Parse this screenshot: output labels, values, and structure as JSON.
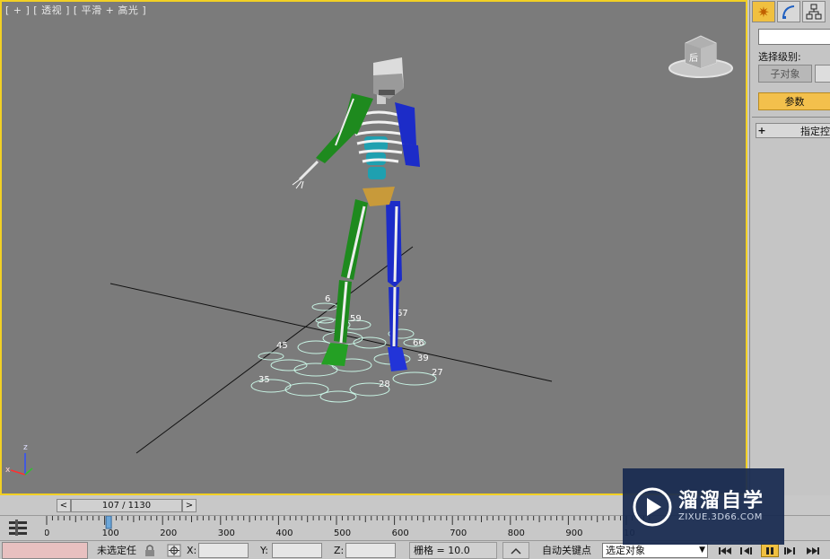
{
  "viewport": {
    "label": "[ + ] [ 透视 ] [ 平滑 + 高光 ]",
    "viewcube_face": "后",
    "axis_z": "z",
    "axis_x": "x",
    "footstep_labels": [
      "6",
      "59",
      "67",
      "45",
      "66",
      "35",
      "27",
      "39",
      "28"
    ]
  },
  "command_panel": {
    "tabs": [
      "create-icon",
      "modify-icon",
      "hierarchy-icon"
    ],
    "active_tab": "create-icon",
    "selection_level_label": "选择级别:",
    "sub_object_button": "子对象",
    "parameters_button": "参数",
    "rollout_plus": "+",
    "rollout_label": "指定控"
  },
  "time_slider": {
    "prev": "<",
    "position": "107 / 1130",
    "next": ">"
  },
  "ruler": {
    "ticks": [
      "0",
      "100",
      "200",
      "300",
      "400",
      "500",
      "600",
      "700",
      "800",
      "900",
      "10"
    ],
    "current_frame": 107
  },
  "status_bar": {
    "selection_text": "未选定任",
    "x_label": "X:",
    "y_label": "Y:",
    "z_label": "Z:",
    "grid": "栅格 = 10.0",
    "auto_key": "自动关键点",
    "selection_set": "选定对象"
  },
  "watermark": {
    "title": "溜溜自学",
    "url": "ZIXUE.3D66.COM"
  },
  "colors": {
    "viewport_bg": "#7b7b7b",
    "viewport_border": "#f2d024",
    "accent": "#f3c04c",
    "left_limbs": "#1e8a1e",
    "right_limbs": "#1c2cc8",
    "footsteps": "#b8f0d8"
  }
}
